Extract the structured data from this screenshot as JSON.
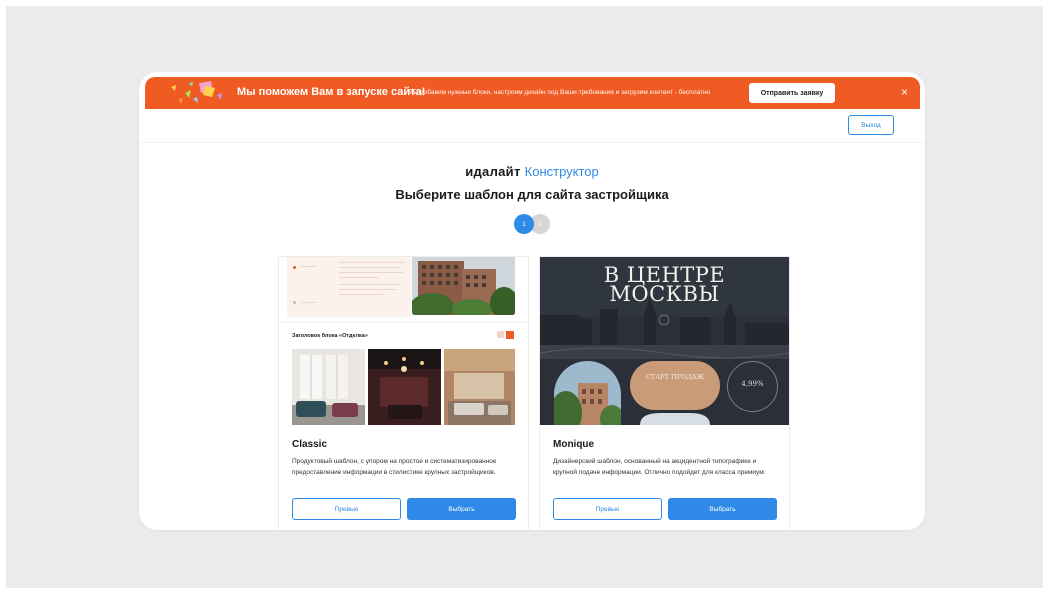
{
  "banner": {
    "title": "Мы поможем Вам в запуске сайта!",
    "description": "Мы добавим нужные блоки, настроим дизайн под Ваши требования и загрузим контент - бесплатно",
    "cta_label": "Отправить заявку",
    "close_glyph": "×",
    "color": "#f05a23"
  },
  "topbar": {
    "exit_label": "Выход"
  },
  "brand": {
    "name": "идалайт",
    "product": "Конструктор"
  },
  "heading": "Выберите шаблон для сайта застройщика",
  "pagination": {
    "pages": [
      "1",
      "2"
    ],
    "current": "1"
  },
  "templates": [
    {
      "name": "Classic",
      "description": "Продуктовый шаблон, с упором на простое и систематизированное предоставление информации в стилистике крупных застройщиков.",
      "preview_label": "Превью",
      "select_label": "Выбрать",
      "screenshot": {
        "block_title": "Заголовок блока «Отделка»"
      }
    },
    {
      "name": "Monique",
      "description": "Дизайнерский шаблон, основанный на акцидентной типографике и крупной подаче информации. Отлично подойдет для класса премиум.",
      "preview_label": "Превью",
      "select_label": "Выбрать",
      "screenshot": {
        "headline_line1": "В ЦЕНТРЕ",
        "headline_line2": "МОСКВЫ",
        "pill_text": "СТАРТ ПРОДАЖ",
        "ring_text": "4,99%"
      }
    }
  ],
  "colors": {
    "accent": "#2e8ae6",
    "banner": "#f05a23",
    "page_bg": "#ebebeb"
  }
}
